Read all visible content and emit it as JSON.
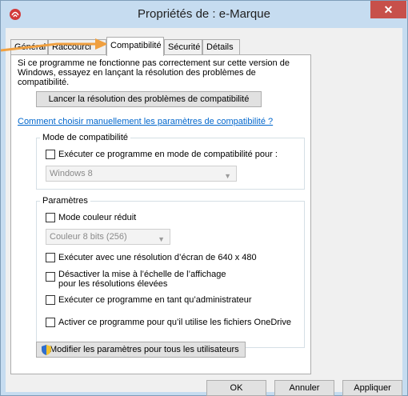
{
  "window": {
    "title": "Propriétés de : e-Marque",
    "close_label": "✕"
  },
  "tabs": [
    {
      "label": "Général"
    },
    {
      "label": "Raccourci"
    },
    {
      "label": "Compatibilité"
    },
    {
      "label": "Sécurité"
    },
    {
      "label": "Détails"
    }
  ],
  "compat": {
    "intro": "Si ce programme ne fonctionne pas correctement sur cette version de Windows, essayez en lançant la résolution des problèmes de compatibilité.",
    "troubleshoot_button": "Lancer la résolution des problèmes de compatibilité",
    "manual_link": "Comment choisir manuellement les paramètres de compatibilité ?",
    "mode_group": {
      "title": "Mode de compatibilité",
      "checkbox_label": "Exécuter ce programme en mode de compatibilité pour :",
      "os_select": "Windows 8"
    },
    "settings_group": {
      "title": "Paramètres",
      "reduced_color_label": "Mode couleur réduit",
      "color_select": "Couleur 8 bits (256)",
      "res_640_label": "Exécuter avec une résolution d’écran de 640 x 480",
      "disable_scaling_label": "Désactiver la mise à l’échelle de l’affichage pour les résolutions élevées",
      "run_as_admin_label": "Exécuter ce programme en tant qu’administrateur",
      "onedrive_label": "Activer ce programme pour qu’il utilise les fichiers OneDrive"
    },
    "all_users_button": "Modifier les paramètres pour tous les utilisateurs"
  },
  "footer": {
    "ok": "OK",
    "cancel": "Annuler",
    "apply": "Appliquer"
  },
  "colors": {
    "accent_arrow": "#f0a040",
    "link": "#0066cc",
    "close": "#c7504a"
  }
}
